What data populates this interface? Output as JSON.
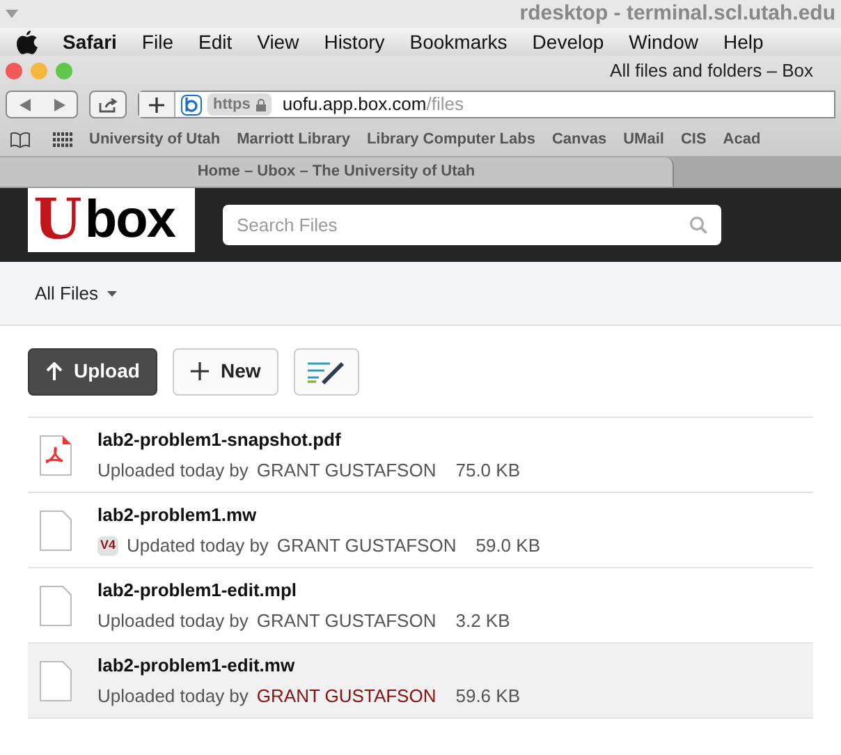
{
  "rdesktop_title": "rdesktop - terminal.scl.utah.edu",
  "menu_bar": [
    "Safari",
    "File",
    "Edit",
    "View",
    "History",
    "Bookmarks",
    "Develop",
    "Window",
    "Help"
  ],
  "window": {
    "title": "All files and folders – Box"
  },
  "address": {
    "scheme": "https",
    "host": "uofu.app.box.com",
    "path": "/files"
  },
  "bookmarks": [
    "University of Utah",
    "Marriott Library",
    "Library Computer Labs",
    "Canvas",
    "UMail",
    "CIS",
    "Acad"
  ],
  "tabs": [
    {
      "label": "Home – Ubox – The University of Utah",
      "selected": true
    }
  ],
  "logo": {
    "letter": "U",
    "word": "box"
  },
  "search": {
    "placeholder": "Search Files"
  },
  "breadcrumb": "All Files",
  "buttons": [
    {
      "kind": "primary",
      "label": "Upload"
    },
    {
      "kind": "new",
      "label": "New"
    },
    {
      "kind": "notes"
    }
  ],
  "files": [
    {
      "name": "lab2-problem1-snapshot.pdf",
      "kind": "pdf",
      "action": "Uploaded today by",
      "user": "GRANT GUSTAFSON",
      "size": "75.0 KB",
      "selected": false
    },
    {
      "name": "lab2-problem1.mw",
      "kind": "generic",
      "version": "V4",
      "action": "Updated today by",
      "user": "GRANT GUSTAFSON",
      "size": "59.0 KB",
      "selected": false
    },
    {
      "name": "lab2-problem1-edit.mpl",
      "kind": "generic",
      "action": "Uploaded today by",
      "user": "GRANT GUSTAFSON",
      "size": "3.2 KB",
      "selected": false
    },
    {
      "name": "lab2-problem1-edit.mw",
      "kind": "generic",
      "action": "Uploaded today by",
      "user": "GRANT GUSTAFSON",
      "size": "59.6 KB",
      "selected": true
    }
  ]
}
